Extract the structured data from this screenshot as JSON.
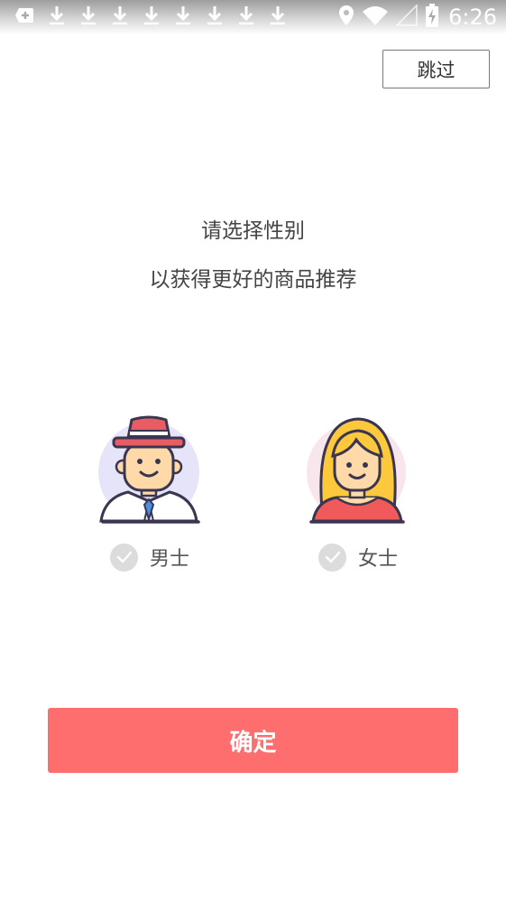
{
  "status_bar": {
    "time": "6:26",
    "left_icons": [
      "add-notification-icon",
      "download-icon",
      "download-icon",
      "download-icon",
      "download-icon",
      "download-icon",
      "download-icon",
      "download-icon",
      "download-icon"
    ],
    "right_icons": [
      "location-icon",
      "wifi-icon",
      "signal-icon",
      "battery-charging-icon"
    ]
  },
  "header": {
    "skip_label": "跳过"
  },
  "prompt": {
    "line1": "请选择性别",
    "line2": "以获得更好的商品推荐"
  },
  "gender_options": [
    {
      "label": "男士",
      "avatar": "man-avatar-icon",
      "checked": false
    },
    {
      "label": "女士",
      "avatar": "woman-avatar-icon",
      "checked": false
    }
  ],
  "confirm_label": "确定",
  "colors": {
    "accent": "#ff6e6e",
    "check_inactive": "#dcdcdc",
    "avatar_bg_male": "#e6e4f8",
    "avatar_bg_female": "#f8e6ec",
    "hat_red": "#e85d64",
    "hair_yellow": "#fcc93c",
    "skin": "#ffd9a8"
  }
}
